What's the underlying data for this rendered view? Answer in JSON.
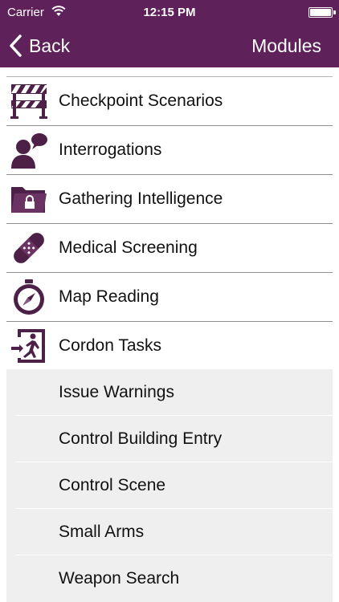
{
  "status_bar": {
    "carrier": "Carrier",
    "time": "12:15 PM"
  },
  "nav": {
    "back_label": "Back",
    "title": "Modules"
  },
  "modules": [
    {
      "label": "Checkpoint Scenarios",
      "icon": "barrier-icon"
    },
    {
      "label": "Interrogations",
      "icon": "person-speech-icon"
    },
    {
      "label": "Gathering Intelligence",
      "icon": "locked-folder-icon"
    },
    {
      "label": "Medical Screening",
      "icon": "bandage-icon"
    },
    {
      "label": "Map Reading",
      "icon": "compass-icon"
    },
    {
      "label": "Cordon Tasks",
      "icon": "exit-door-icon"
    }
  ],
  "cordon_subtasks": [
    {
      "label": "Issue Warnings"
    },
    {
      "label": "Control Building Entry"
    },
    {
      "label": "Control Scene"
    },
    {
      "label": "Small Arms"
    },
    {
      "label": "Weapon Search"
    }
  ],
  "colors": {
    "nav_background": "#5e2159",
    "icon_color": "#4d2047",
    "submenu_background": "#efeff0"
  }
}
